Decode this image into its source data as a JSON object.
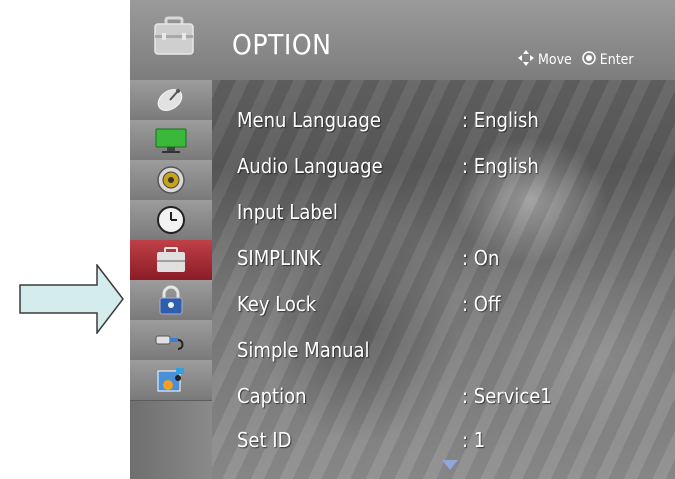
{
  "header": {
    "title": "OPTION",
    "hint_move": "Move",
    "hint_enter": "Enter"
  },
  "sidebar": {
    "items": [
      {
        "icon": "satellite-dish-icon"
      },
      {
        "icon": "monitor-icon"
      },
      {
        "icon": "speaker-icon"
      },
      {
        "icon": "clock-icon"
      },
      {
        "icon": "toolbox-icon",
        "selected": true
      },
      {
        "icon": "padlock-icon"
      },
      {
        "icon": "input-plug-icon"
      },
      {
        "icon": "media-icon"
      }
    ]
  },
  "menu": {
    "rows": [
      {
        "label": "Menu Language",
        "value": ": English"
      },
      {
        "label": "Audio Language",
        "value": ": English"
      },
      {
        "label": "Input Label",
        "value": ""
      },
      {
        "label": "SIMPLINK",
        "value": ": On"
      },
      {
        "label": "Key Lock",
        "value": ": Off"
      },
      {
        "label": "Simple Manual",
        "value": ""
      },
      {
        "label": "Caption",
        "value": ": Service1"
      },
      {
        "label": "Set ID",
        "value": ": 1"
      }
    ]
  },
  "colors": {
    "selected_icon_bg": "#a52a33",
    "arrow_fill": "#d4ecec",
    "arrow_stroke": "#3b3b3b"
  }
}
